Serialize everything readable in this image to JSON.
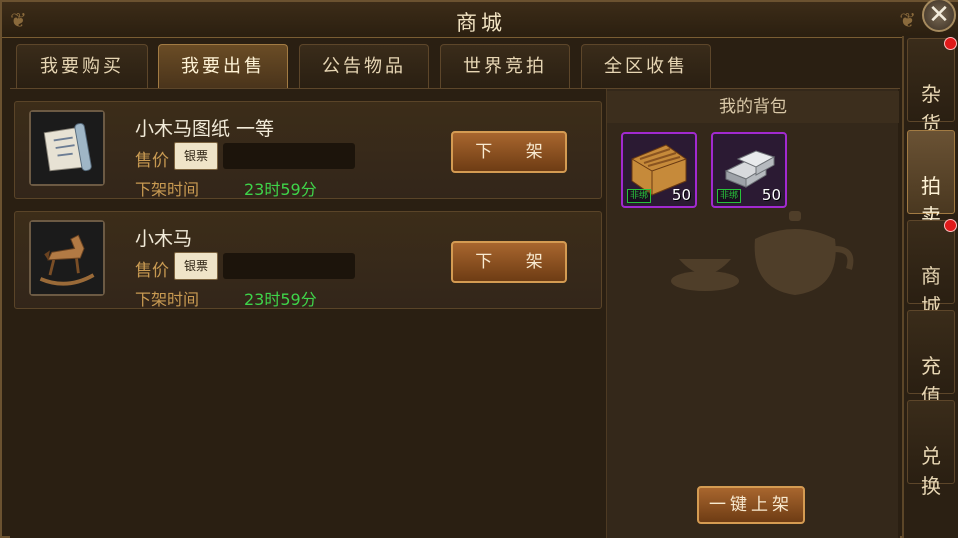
{
  "window": {
    "title": "商城"
  },
  "tabs": [
    {
      "label": "我要购买",
      "active": false
    },
    {
      "label": "我要出售",
      "active": true
    },
    {
      "label": "公告物品",
      "active": false
    },
    {
      "label": "世界竞拍",
      "active": false
    },
    {
      "label": "全区收售",
      "active": false
    }
  ],
  "listings": [
    {
      "name": "小木马图纸 一等",
      "price_label": "售价",
      "currency": "银票",
      "time_label": "下架时间",
      "time_value": "23时59分",
      "button": "下 架",
      "icon": "scroll-blueprint-icon"
    },
    {
      "name": "小木马",
      "price_label": "售价",
      "currency": "银票",
      "time_label": "下架时间",
      "time_value": "23时59分",
      "button": "下 架",
      "icon": "rocking-horse-icon"
    }
  ],
  "bag": {
    "title": "我的背包",
    "items": [
      {
        "icon": "wood-plank-icon",
        "tag": "非绑",
        "count": "50"
      },
      {
        "icon": "silver-ingot-icon",
        "tag": "非绑",
        "count": "50"
      }
    ],
    "onekey_button": "一键上架"
  },
  "sidenav": [
    {
      "label": "杂\n货",
      "badge": true,
      "active": false
    },
    {
      "label": "拍\n卖",
      "badge": false,
      "active": true
    },
    {
      "label": "商\n城",
      "badge": true,
      "active": false
    },
    {
      "label": "充\n值",
      "badge": false,
      "active": false
    },
    {
      "label": "兑\n换",
      "badge": false,
      "active": false
    }
  ],
  "colors": {
    "accent_gold": "#c89a52",
    "timer_green": "#3fd44a",
    "badge_red": "#e01a1a",
    "rarity_purple": "#a12ad0"
  }
}
